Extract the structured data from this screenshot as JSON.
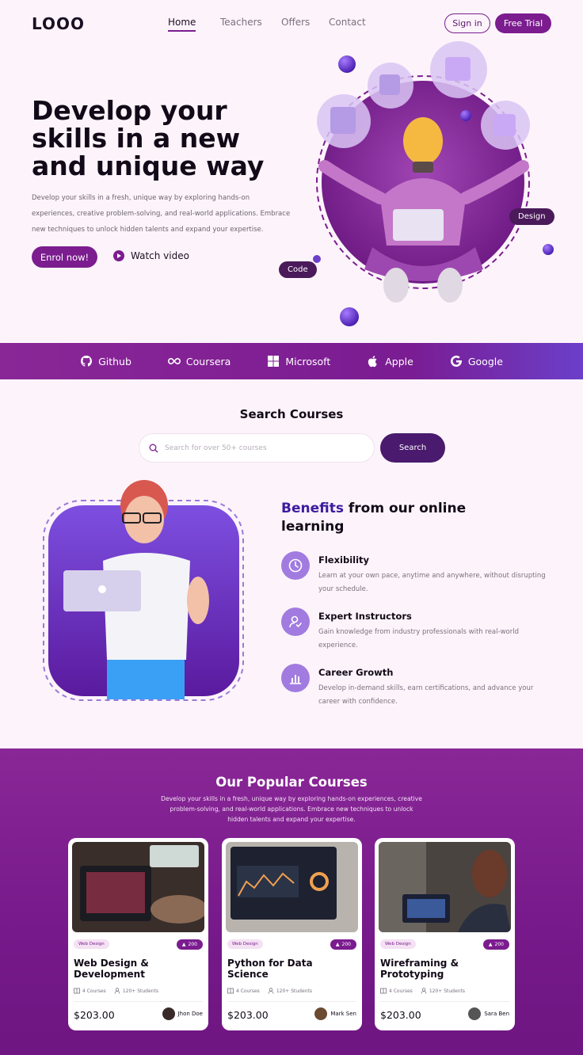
{
  "nav": {
    "logo": "LOOO",
    "links": [
      "Home",
      "Teachers",
      "Offers",
      "Contact"
    ],
    "sign_in": "Sign in",
    "free_trial": "Free Trial"
  },
  "hero": {
    "title": "Develop your skills in a new and unique way",
    "description": "Develop your skills in a fresh, unique way by exploring hands-on experiences, creative problem-solving, and real-world applications. Embrace new techniques to unlock hidden talents and expand your expertise.",
    "enrol": "Enrol now!",
    "watch": "Watch video",
    "pill_design": "Design",
    "pill_code": "Code"
  },
  "brands": [
    "Github",
    "Coursera",
    "Microsoft",
    "Apple",
    "Google"
  ],
  "search": {
    "title": "Search Courses",
    "placeholder": "Search for over 50+ courses",
    "button": "Search"
  },
  "benefits": {
    "title_highlight": "Benefits",
    "title_rest": " from our online learning",
    "items": [
      {
        "title": "Flexibility",
        "text": "Learn at your own pace, anytime and anywhere, without disrupting your schedule.",
        "icon": "clock-icon"
      },
      {
        "title": "Expert Instructors",
        "text": "Gain knowledge from industry professionals with real-world experience.",
        "icon": "user-check-icon"
      },
      {
        "title": "Career Growth",
        "text": "Develop in-demand skills, earn certifications, and advance your career with confidence.",
        "icon": "bar-chart-icon"
      }
    ]
  },
  "popular": {
    "title": "Our Popular Courses",
    "description": "Develop your skills in a fresh, unique way by exploring hands-on experiences, creative problem-solving, and real-world applications. Embrace new techniques to unlock hidden talents and expand your expertise.",
    "courses": [
      {
        "tag": "Web Design",
        "rating": "200",
        "title": "Web Design & Development",
        "courses": "4 Courses",
        "students": "120+ Students",
        "price": "$203.00",
        "author": "Jhon Doe"
      },
      {
        "tag": "Web Design",
        "rating": "200",
        "title": "Python for Data Science",
        "courses": "4 Courses",
        "students": "120+ Students",
        "price": "$203.00",
        "author": "Mark Sen"
      },
      {
        "tag": "Web Design",
        "rating": "200",
        "title": "Wireframing & Prototyping",
        "courses": "4 Courses",
        "students": "120+ Students",
        "price": "$203.00",
        "author": "Sara Ben"
      }
    ]
  },
  "colors": {
    "accent": "#7b1c8f",
    "dark_accent": "#4a1a6e",
    "background": "#fdf4fb"
  }
}
